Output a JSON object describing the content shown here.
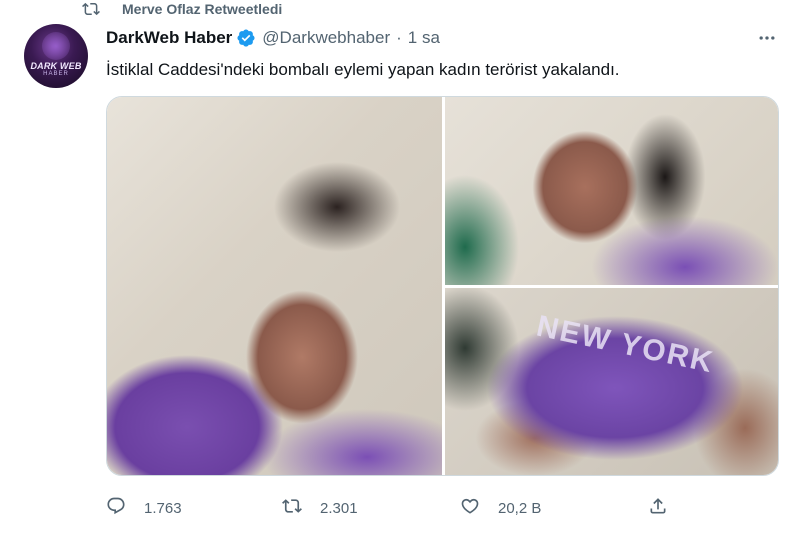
{
  "retweet": {
    "text": "Merve Oflaz Retweetledi",
    "icon": "retweet-icon"
  },
  "author": {
    "name": "DarkWeb Haber",
    "handle": "@Darkwebhaber",
    "time": "1 sa",
    "verified": true,
    "avatar_text_top": "DARK WEB",
    "avatar_text_bottom": "HABER"
  },
  "tweet": {
    "text": "İstiklal Caddesi'ndeki bombalı eylemi yapan kadın terörist yakalandı."
  },
  "media": {
    "photo3_print": "NEW YORK"
  },
  "actions": {
    "reply_count": "1.763",
    "retweet_count": "2.301",
    "like_count": "20,2 B"
  },
  "colors": {
    "text": "#0f1419",
    "muted": "#536471",
    "verified": "#1d9bf0"
  }
}
